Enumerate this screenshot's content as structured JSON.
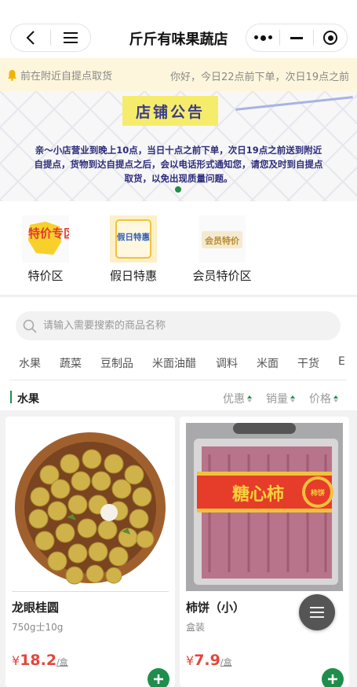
{
  "header": {
    "title": "斤斤有味果蔬店",
    "back_icon": "chevron-left-icon",
    "menu_icon": "hamburger-icon",
    "more_icon": "more-dots-icon",
    "minimize_icon": "minus-icon",
    "close_icon": "record-icon"
  },
  "notice": {
    "pickup_text": "前在附近自提点取货",
    "scroll_text": "你好，今日22点前下单，次日19点之前"
  },
  "banner": {
    "title": "店铺公告",
    "text": "亲～小店营业到晚上10点，当日十点之前下单，次日19点之前送到附近自提点，货物到达自提点之后，会以电话形式通知您，请您及时到自提点取货，以免出现质量问题。"
  },
  "categories": [
    {
      "label": "特价区",
      "icon_text": "特价专区"
    },
    {
      "label": "假日特惠",
      "icon_text": "假日特惠"
    },
    {
      "label": "会员特价区",
      "icon_text": "会员特价"
    }
  ],
  "search": {
    "placeholder": "请输入需要搜索的商品名称"
  },
  "tabs": [
    "水果",
    "蔬菜",
    "豆制品",
    "米面油醋",
    "调料",
    "米面",
    "干货",
    "E"
  ],
  "section": {
    "title": "水果",
    "sorts": [
      "优惠",
      "销量",
      "价格"
    ]
  },
  "products": [
    {
      "name": "龙眼桂圆",
      "spec": "750g士10g",
      "currency": "¥",
      "price": "18.2",
      "unit": "/盒"
    },
    {
      "name": "柿饼（小）",
      "spec": "盒装",
      "currency": "¥",
      "price": "7.9",
      "unit": "/盒",
      "label_text": "糖心柿",
      "badge_text": "柿饼"
    }
  ],
  "colors": {
    "accent": "#1f8e4c",
    "price": "#e0483c",
    "notice_bg": "#fdf6dc"
  }
}
